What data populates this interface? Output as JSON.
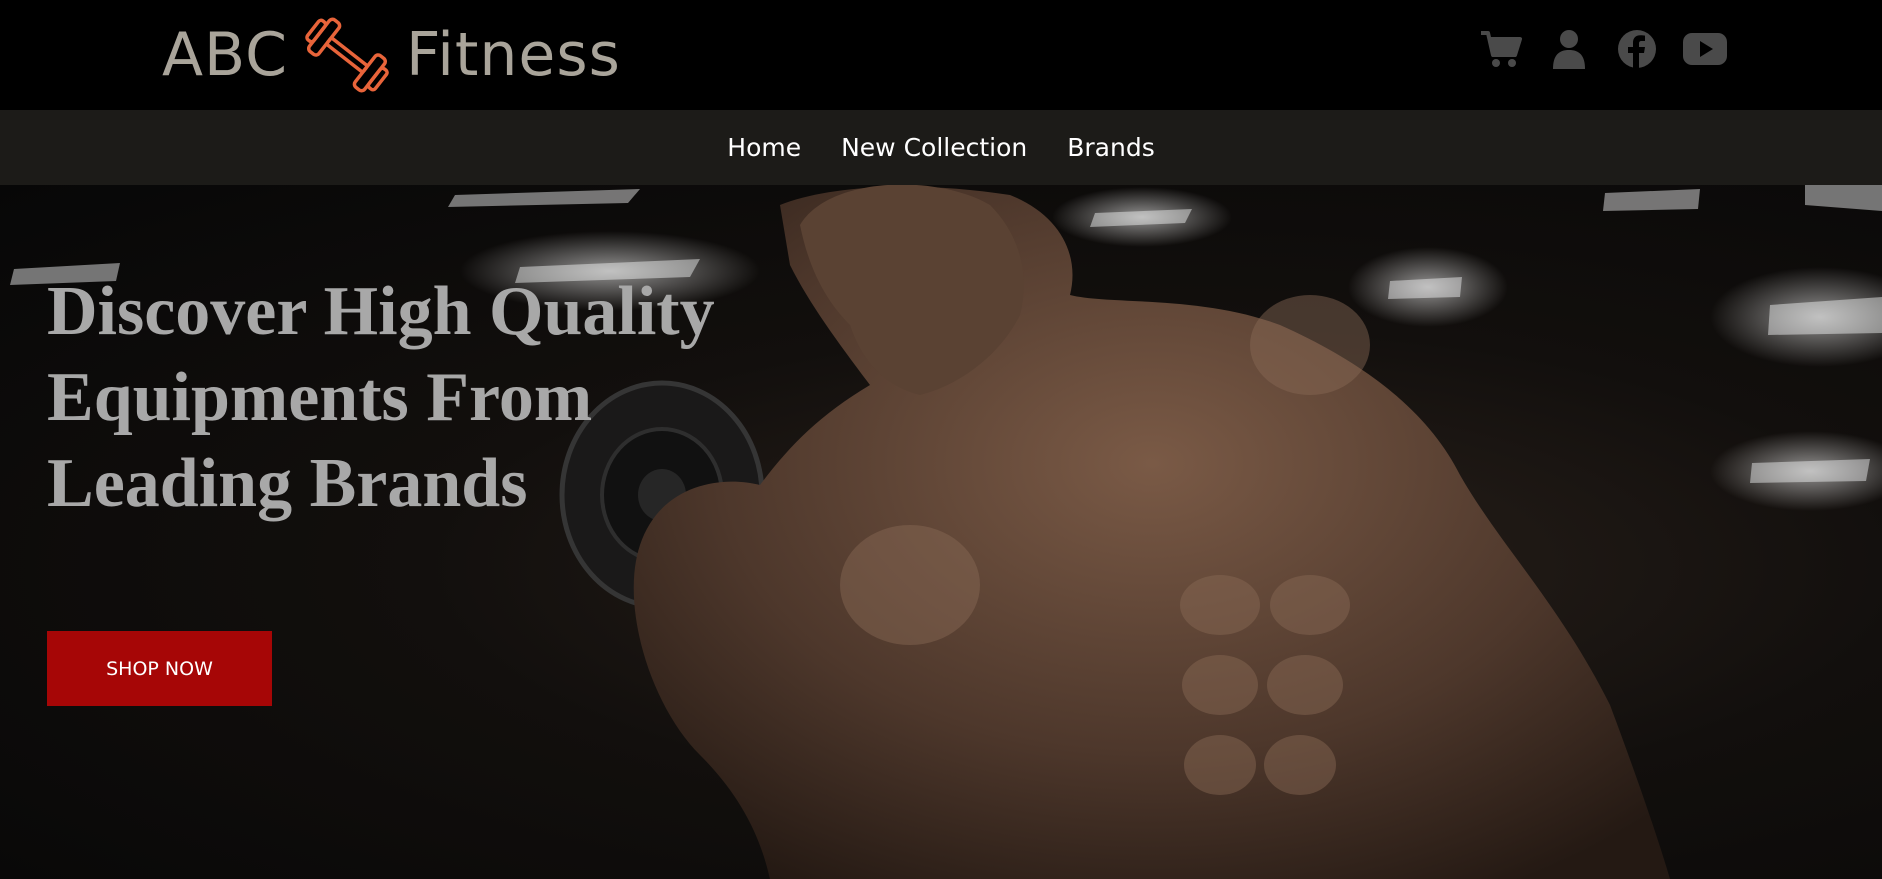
{
  "header": {
    "brand_left": "ABC",
    "brand_right": "Fitness",
    "logo_icon": "dumbbell-icon",
    "accent_color": "#e8643a",
    "icons": [
      "cart-icon",
      "user-icon",
      "facebook-icon",
      "youtube-icon"
    ]
  },
  "nav": {
    "items": [
      {
        "label": "Home"
      },
      {
        "label": "New Collection"
      },
      {
        "label": "Brands"
      }
    ]
  },
  "hero": {
    "title": "Discover High Quality Equipments From Leading Brands",
    "cta_label": "SHOP NOW",
    "cta_color": "#a60606",
    "image": "bodybuilder-curling-dumbbell-in-gym"
  }
}
